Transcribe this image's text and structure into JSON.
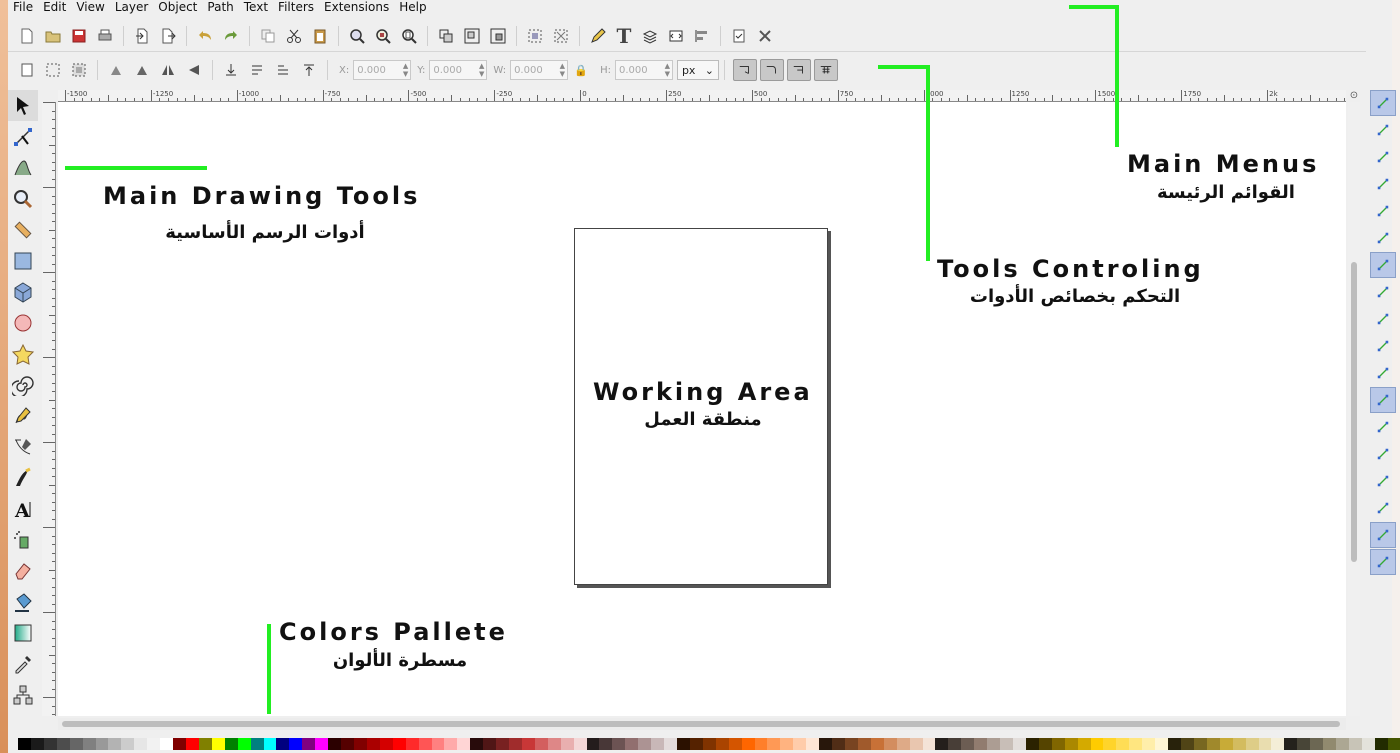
{
  "menus": [
    "File",
    "Edit",
    "View",
    "Layer",
    "Object",
    "Path",
    "Text",
    "Filters",
    "Extensions",
    "Help"
  ],
  "command_toolbar": {
    "icons": [
      "new-document-icon",
      "open-icon",
      "save-icon",
      "print-icon",
      "import-icon",
      "export-icon",
      "undo-icon",
      "redo-icon",
      "duplicate-icon",
      "cut-icon",
      "paste-icon",
      "zoom-selection-icon",
      "zoom-drawing-icon",
      "zoom-page-icon",
      "group-icon",
      "ungroup-icon",
      "clone-icon",
      "align-icon",
      "distribute-icon",
      "xml-editor-icon",
      "text-icon",
      "layers-icon",
      "fill-stroke-icon",
      "transform-icon",
      "preferences-icon",
      "document-properties-icon"
    ]
  },
  "controls_bar": {
    "x_label": "X:",
    "x_value": "0.000",
    "y_label": "Y:",
    "y_value": "0.000",
    "w_label": "W:",
    "w_value": "0.000",
    "h_label": "H:",
    "h_value": "0.000",
    "unit": "px"
  },
  "ruler_labels": [
    "-1500",
    "-1250",
    "-1000",
    "-750",
    "-500",
    "-250",
    "0",
    "250",
    "500",
    "750",
    "1000",
    "1250",
    "1500",
    "1750",
    "2k"
  ],
  "tools": [
    "selector-tool-icon",
    "node-tool-icon",
    "tweak-tool-icon",
    "zoom-tool-icon",
    "measure-tool-icon",
    "rectangle-tool-icon",
    "3d-box-tool-icon",
    "ellipse-tool-icon",
    "star-tool-icon",
    "spiral-tool-icon",
    "pencil-tool-icon",
    "pen-tool-icon",
    "calligraphy-tool-icon",
    "text-tool-icon",
    "spray-tool-icon",
    "eraser-tool-icon",
    "paint-bucket-tool-icon",
    "gradient-tool-icon",
    "dropper-tool-icon",
    "connector-tool-icon"
  ],
  "annotations": {
    "main_menus_en": "Main Menus",
    "main_menus_ar": "القوائم الرئيسة",
    "main_drawing_tools_en": "Main Drawing Tools",
    "main_drawing_tools_ar": "أدوات الرسم الأساسية",
    "tools_controling_en": "Tools Controling",
    "tools_controling_ar": "التحكم بخصائص الأدوات",
    "working_area_en": "Working Area",
    "working_area_ar": "منطقة العمل",
    "colors_pallete_en": "Colors Pallete",
    "colors_pallete_ar": "مسطرة الألوان"
  },
  "colors": {
    "accent_line": "#22ee22",
    "palette": [
      "#000000",
      "#1a1a1a",
      "#333333",
      "#4d4d4d",
      "#666666",
      "#808080",
      "#999999",
      "#b3b3b3",
      "#cccccc",
      "#e6e6e6",
      "#f2f2f2",
      "#ffffff",
      "#800000",
      "#ff0000",
      "#808000",
      "#ffff00",
      "#008000",
      "#00ff00",
      "#008080",
      "#00ffff",
      "#000080",
      "#0000ff",
      "#800080",
      "#ff00ff",
      "#2b0000",
      "#550000",
      "#800000",
      "#aa0000",
      "#d40000",
      "#ff0000",
      "#ff2a2a",
      "#ff5555",
      "#ff8080",
      "#ffaaaa",
      "#ffd5d5",
      "#280b0b",
      "#501616",
      "#782121",
      "#a02c2c",
      "#c83737",
      "#d35f5f",
      "#de8787",
      "#e9afaf",
      "#f4d7d7",
      "#241c1c",
      "#483737",
      "#6c5353",
      "#916f6f",
      "#ac9393",
      "#c8b7b7",
      "#e3dbdb",
      "#2b1100",
      "#552200",
      "#803300",
      "#aa4400",
      "#d45500",
      "#ff6600",
      "#ff7f2a",
      "#ff9955",
      "#ffb380",
      "#ffccaa",
      "#ffe6d5",
      "#28170b",
      "#502d16",
      "#784421",
      "#a05a2c",
      "#c87137",
      "#d38d5f",
      "#deaa87",
      "#e9c6af",
      "#f4e3d7",
      "#241f1c",
      "#483e37",
      "#6c5d53",
      "#917c6f",
      "#ac9d93",
      "#c8beb7",
      "#e3dedb",
      "#2b2200",
      "#554400",
      "#806600",
      "#aa8800",
      "#d4aa00",
      "#ffcc00",
      "#ffd42a",
      "#ffdd55",
      "#ffe680",
      "#ffeeaa",
      "#fff6d5",
      "#28220b",
      "#504416",
      "#786721",
      "#a0892c",
      "#c8ab37",
      "#d3bc5f",
      "#decd87",
      "#e9ddaf",
      "#f4eed7",
      "#24221c",
      "#484537",
      "#6c6753",
      "#918a6f",
      "#aca793",
      "#c8c4b7",
      "#e3e2db",
      "#222b00",
      "#445500"
    ]
  }
}
